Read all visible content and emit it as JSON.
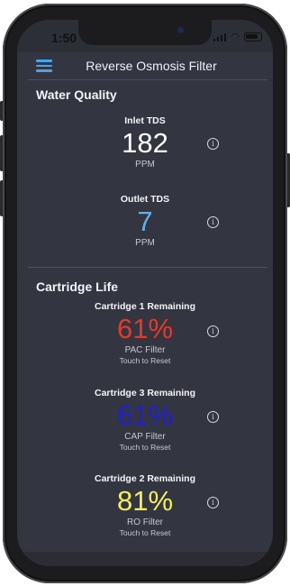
{
  "status_bar": {
    "time": "1:50"
  },
  "navbar": {
    "title": "Reverse Osmosis Filter",
    "menu_icon": "hamburger-icon"
  },
  "water_quality": {
    "title": "Water Quality",
    "inlet": {
      "label": "Inlet TDS",
      "value": "182",
      "unit": "PPM",
      "color": "#ffffff"
    },
    "outlet": {
      "label": "Outlet TDS",
      "value": "7",
      "unit": "PPM",
      "color": "#5ab3ee"
    }
  },
  "cartridge_life": {
    "title": "Cartridge Life",
    "cartridges": [
      {
        "label": "Cartridge 1 Remaining",
        "value": "61%",
        "filter": "PAC Filter",
        "action": "Touch to Reset",
        "color": "#e23b28"
      },
      {
        "label": "Cartridge 3 Remaining",
        "value": "61%",
        "filter": "CAP Filter",
        "action": "Touch to Reset",
        "color": "#1f1fd6"
      },
      {
        "label": "Cartridge 2 Remaining",
        "value": "81%",
        "filter": "RO Filter",
        "action": "Touch to Reset",
        "color": "#f1f058"
      }
    ]
  },
  "icons": {
    "info": "info-icon",
    "info_glyph": "i"
  }
}
